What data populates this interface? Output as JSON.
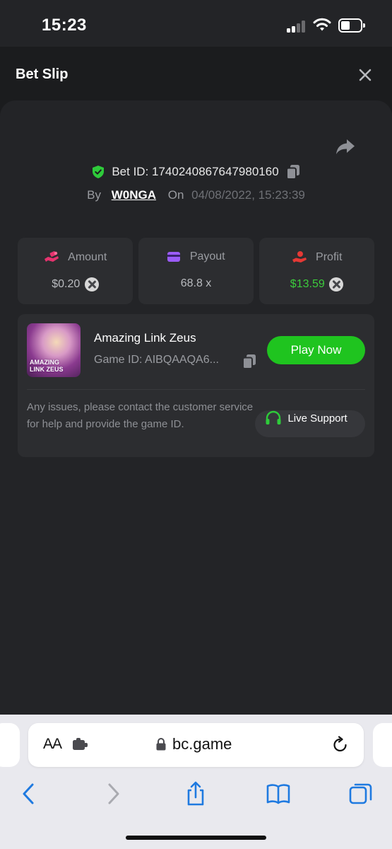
{
  "status_bar": {
    "time": "15:23"
  },
  "header": {
    "title": "Bet Slip"
  },
  "bet": {
    "id_label": "Bet ID: 1740240867647980160",
    "by_label": "By",
    "user": "W0NGA",
    "on_label": "On",
    "date": "04/08/2022, 15:23:39"
  },
  "stats": [
    {
      "label": "Amount",
      "value": "$0.20",
      "icon": "hand-coins-icon",
      "value_color": "#b9bbbf"
    },
    {
      "label": "Payout",
      "value": "68.8 x",
      "icon": "wallet-card-icon",
      "value_color": "#b9bbbf"
    },
    {
      "label": "Profit",
      "value": "$13.59",
      "icon": "hand-money-icon",
      "value_color": "#3ccb3c"
    }
  ],
  "game": {
    "thumbnail_text": "AMAZING LINK ZEUS",
    "title": "Amazing Link Zeus",
    "id_label": "Game ID: AIBQAAQA6...",
    "play_label": "Play Now",
    "help_text": "Any issues, please contact the customer service for help and provide the game ID.",
    "support_label": "Live Support"
  },
  "browser": {
    "text_size_label": "AA",
    "url": "bc.game"
  },
  "colors": {
    "accent_green": "#1fc41f",
    "shield_green": "#2ecb3a",
    "amount_pink": "#e5336e",
    "payout_purple": "#9b5cf6",
    "profit_red": "#e53935",
    "ios_blue": "#1f7ae0"
  }
}
